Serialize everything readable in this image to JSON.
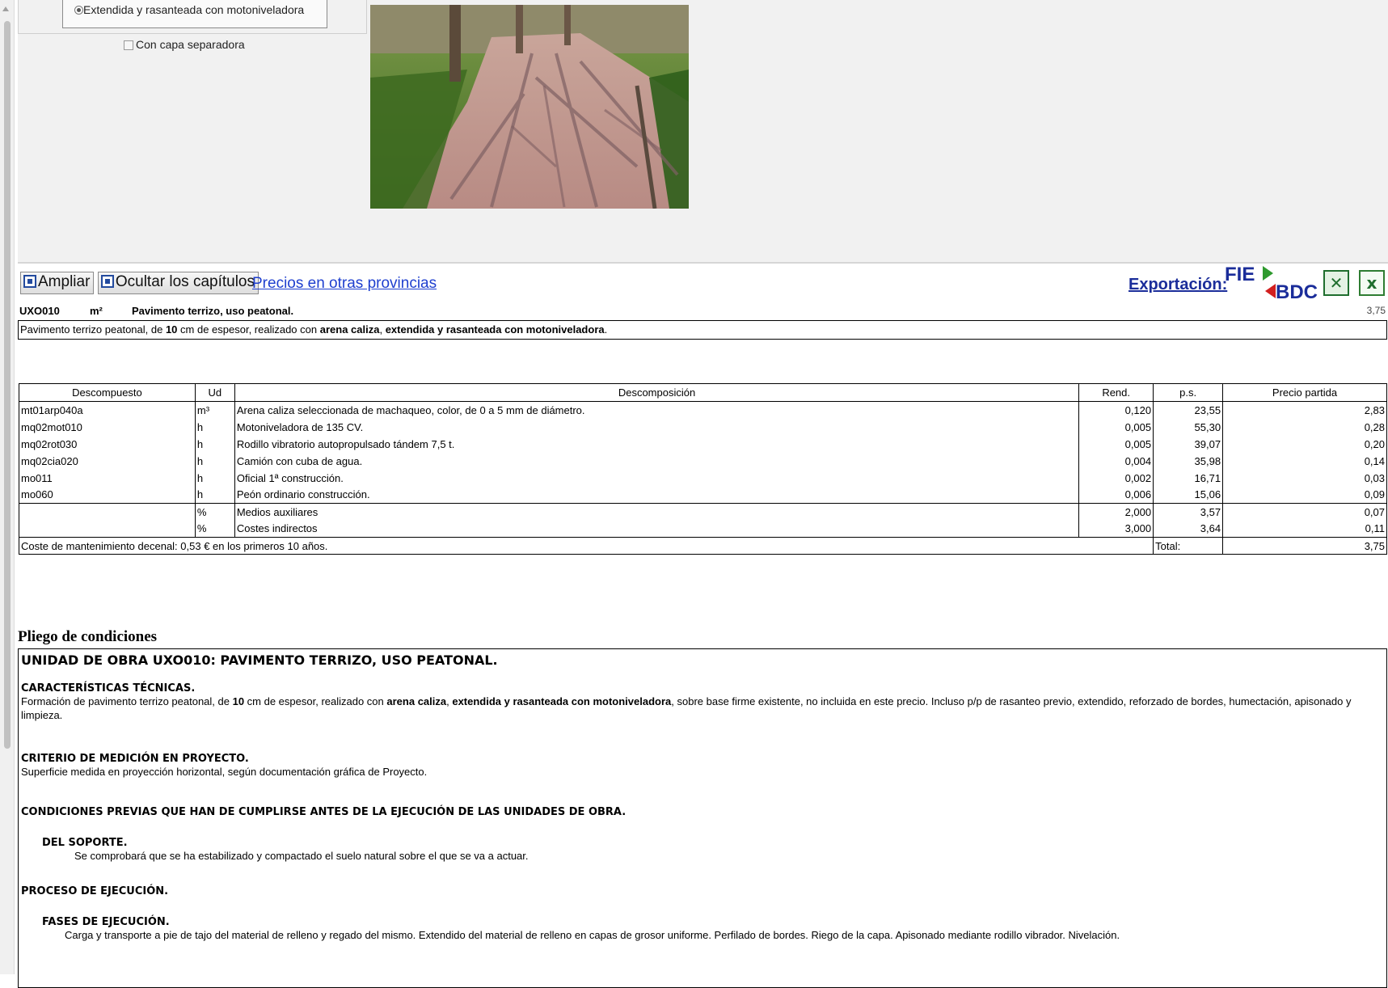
{
  "top_panel": {
    "radio_label": "Extendida y rasanteada con motoniveladora",
    "checkbox_label": "Con capa separadora"
  },
  "toolbar": {
    "ampliar_label": "Ampliar",
    "ocultar_label": "Ocultar  los  capítulos",
    "precios_link": "Precios en otras provincias",
    "export_label": "Exportación",
    "export_colon": ":",
    "fie_logo_text": "FIE BDC"
  },
  "unit": {
    "code": "UXO010",
    "measure": "m²",
    "title": "Pavimento terrizo, uso peatonal.",
    "price": "3,75",
    "description_parts": [
      {
        "text": "Pavimento terrizo peatonal, de ",
        "bold": false
      },
      {
        "text": "10",
        "bold": true
      },
      {
        "text": " cm de espesor, realizado con ",
        "bold": false
      },
      {
        "text": "arena caliza",
        "bold": true
      },
      {
        "text": ", ",
        "bold": false
      },
      {
        "text": "extendida y rasanteada con motoniveladora",
        "bold": true
      },
      {
        "text": ".",
        "bold": false
      }
    ]
  },
  "table": {
    "headers": [
      "Descompuesto",
      "Ud",
      "Descomposición",
      "Rend.",
      "p.s.",
      "Precio partida"
    ],
    "rows": [
      {
        "code": "mt01arp040a",
        "ud": "m³",
        "desc": "Arena caliza seleccionada de machaqueo, color, de 0 a 5 mm de diámetro.",
        "rend": "0,120",
        "ps": "23,55",
        "price": "2,83"
      },
      {
        "code": "mq02mot010",
        "ud": "h",
        "desc": "Motoniveladora de 135 CV.",
        "rend": "0,005",
        "ps": "55,30",
        "price": "0,28"
      },
      {
        "code": "mq02rot030",
        "ud": "h",
        "desc": "Rodillo vibratorio autopropulsado tándem 7,5 t.",
        "rend": "0,005",
        "ps": "39,07",
        "price": "0,20"
      },
      {
        "code": "mq02cia020",
        "ud": "h",
        "desc": "Camión con cuba de agua.",
        "rend": "0,004",
        "ps": "35,98",
        "price": "0,14"
      },
      {
        "code": "mo011",
        "ud": "h",
        "desc": "Oficial 1ª construcción.",
        "rend": "0,002",
        "ps": "16,71",
        "price": "0,03"
      },
      {
        "code": "mo060",
        "ud": "h",
        "desc": "Peón ordinario construcción.",
        "rend": "0,006",
        "ps": "15,06",
        "price": "0,09"
      }
    ],
    "extra_rows": [
      {
        "code": "",
        "ud": "%",
        "desc": "Medios auxiliares",
        "rend": "2,000",
        "ps": "3,57",
        "price": "0,07"
      },
      {
        "code": "",
        "ud": "%",
        "desc": "Costes indirectos",
        "rend": "3,000",
        "ps": "3,64",
        "price": "0,11"
      }
    ],
    "footer": {
      "maintenance": "Coste de mantenimiento decenal: 0,53 € en los primeros 10 años.",
      "total_label": "Total:",
      "total_value": "3,75"
    }
  },
  "conditions": {
    "section_title": "Pliego de condiciones",
    "main_heading": "UNIDAD DE OBRA UXO010: PAVIMENTO TERRIZO, USO PEATONAL.",
    "tech_heading": "CARACTERÍSTICAS TÉCNICAS.",
    "tech_parts": [
      {
        "text": "Formación de pavimento terrizo peatonal, de ",
        "bold": false
      },
      {
        "text": "10",
        "bold": true
      },
      {
        "text": " cm de espesor, realizado con ",
        "bold": false
      },
      {
        "text": "arena caliza",
        "bold": true
      },
      {
        "text": ", ",
        "bold": false
      },
      {
        "text": "extendida y rasanteada con motoniveladora",
        "bold": true
      },
      {
        "text": ", sobre base firme existente, no incluida en este precio. Incluso p/p de rasanteo previo, extendido, reforzado de bordes, humectación, apisonado y limpieza.",
        "bold": false
      }
    ],
    "measure_heading": "CRITERIO DE MEDICIÓN EN PROYECTO.",
    "measure_text": "Superficie medida en proyección horizontal, según documentación gráfica de Proyecto.",
    "prev_heading": "CONDICIONES PREVIAS QUE HAN DE CUMPLIRSE ANTES DE LA EJECUCIÓN DE LAS UNIDADES DE OBRA.",
    "support_heading": "DEL SOPORTE.",
    "support_text": "Se comprobará que se ha estabilizado y compactado el suelo natural sobre el que se va a actuar.",
    "process_heading": "PROCESO DE EJECUCIÓN.",
    "phases_heading": "FASES DE EJECUCIÓN.",
    "phases_text": "Carga y transporte a pie de tajo del material de relleno y regado del mismo. Extendido del material de relleno en capas de grosor uniforme. Perfilado de bordes. Riego de la capa. Apisonado mediante rodillo vibrador. Nivelación."
  },
  "colors": {
    "link": "#1e3fcf",
    "export": "#1b2d9a",
    "panel_bg": "#f1f1f1"
  }
}
